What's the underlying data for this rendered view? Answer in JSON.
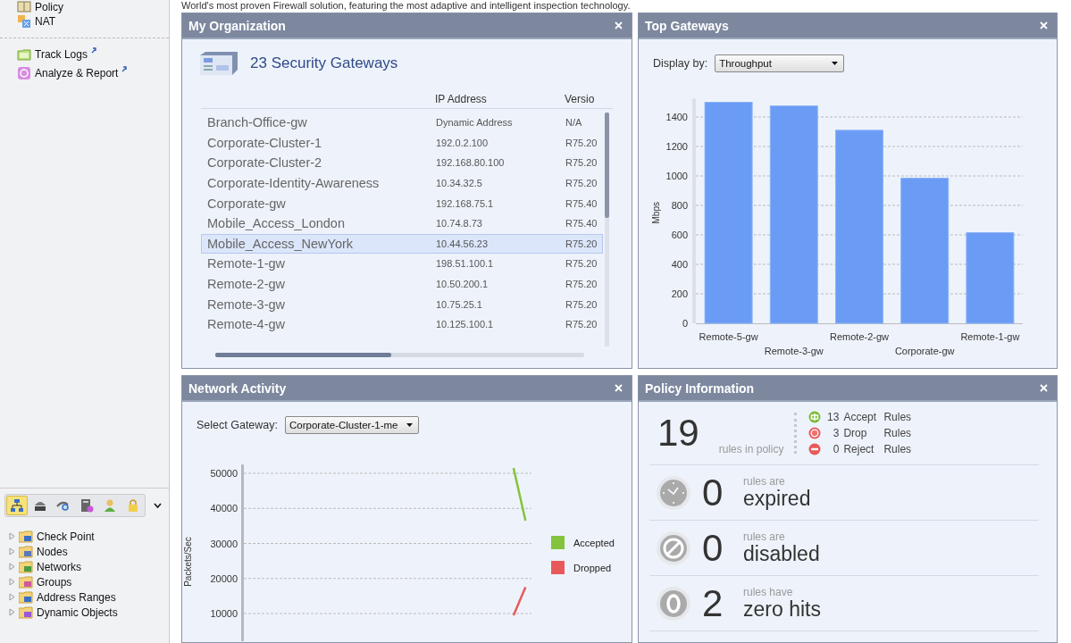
{
  "banner": {
    "text": "World's most proven Firewall solution, featuring the most adaptive and intelligent inspection technology."
  },
  "sidebar": {
    "top_items": [
      {
        "label": "Policy"
      },
      {
        "label": "NAT"
      }
    ],
    "links": [
      {
        "label": "Track Logs"
      },
      {
        "label": "Analyze & Report"
      }
    ],
    "toolbar": [
      {
        "selected": true
      },
      {
        "selected": false
      },
      {
        "selected": false
      },
      {
        "selected": false
      },
      {
        "selected": false
      },
      {
        "selected": false
      }
    ],
    "tree": [
      {
        "label": "Check Point",
        "expanded": false
      },
      {
        "label": "Nodes",
        "expanded": false
      },
      {
        "label": "Networks",
        "expanded": false
      },
      {
        "label": "Groups",
        "expanded": false
      },
      {
        "label": "Address Ranges",
        "expanded": false
      },
      {
        "label": "Dynamic Objects",
        "expanded": false
      }
    ]
  },
  "my_organization": {
    "title": "My Organization",
    "heading": "23 Security Gateways",
    "columns": [
      "IP Address",
      "Versio"
    ],
    "rows": [
      {
        "name": "Branch-Office-gw",
        "ip_address": "Dynamic Address",
        "column_3": "N/A",
        "selected": false
      },
      {
        "name": "Corporate-Cluster-1",
        "ip_address": "192.0.2.100",
        "column_3": "R75.20",
        "selected": false
      },
      {
        "name": "Corporate-Cluster-2",
        "ip_address": "192.168.80.100",
        "column_3": "R75.20",
        "selected": false
      },
      {
        "name": "Corporate-Identity-Awareness",
        "ip_address": "10.34.32.5",
        "column_3": "R75.20",
        "selected": false
      },
      {
        "name": "Corporate-gw",
        "ip_address": "192.168.75.1",
        "column_3": "R75.40",
        "selected": false
      },
      {
        "name": "Mobile_Access_London",
        "ip_address": "10.74.8.73",
        "column_3": "R75.40",
        "selected": false
      },
      {
        "name": "Mobile_Access_NewYork",
        "ip_address": "10.44.56.23",
        "column_3": "R75.20",
        "selected": true
      },
      {
        "name": "Remote-1-gw",
        "ip_address": "198.51.100.1",
        "column_3": "R75.20",
        "selected": false
      },
      {
        "name": "Remote-2-gw",
        "ip_address": "10.50.200.1",
        "column_3": "R75.20",
        "selected": false
      },
      {
        "name": "Remote-3-gw",
        "ip_address": "10.75.25.1",
        "column_3": "R75.20",
        "selected": false
      },
      {
        "name": "Remote-4-gw",
        "ip_address": "10.125.100.1",
        "column_3": "R75.20",
        "selected": false
      }
    ]
  },
  "top_gateways": {
    "title": "Top Gateways",
    "display_label": "Display by:",
    "display_value": "Throughput",
    "chart_data": {
      "type": "bar",
      "ylabel": "Mbps",
      "categories": [
        "Remote-5-gw",
        "Remote-3-gw",
        "Remote-2-gw",
        "Corporate-gw",
        "Remote-1-gw"
      ],
      "values": [
        1500,
        1475,
        1310,
        985,
        615
      ],
      "ylim": [
        0,
        1500
      ],
      "yticks": [
        0,
        200,
        400,
        600,
        800,
        1000,
        1200,
        1400
      ],
      "grid": true
    }
  },
  "network_activity": {
    "title": "Network Activity",
    "select_label": "Select Gateway:",
    "select_value": "Corporate-Cluster-1-me",
    "chart_data": {
      "type": "line",
      "ylabel": "Packets/Sec",
      "categories": [
        null,
        null,
        null,
        null,
        null,
        null,
        null,
        null,
        null,
        null,
        null,
        null,
        null,
        null,
        null,
        null,
        null,
        null,
        null,
        null,
        null,
        null,
        null,
        null
      ],
      "ylim": [
        2100,
        52500
      ],
      "yticks": [
        10000,
        20000,
        30000,
        40000,
        50000
      ],
      "grid": true,
      "legend": "right",
      "series": [
        {
          "name": "Accepted",
          "color": "#84c43c",
          "values": [
            null,
            null,
            null,
            null,
            null,
            null,
            null,
            null,
            null,
            null,
            null,
            null,
            null,
            null,
            null,
            null,
            null,
            null,
            null,
            null,
            null,
            null,
            51500,
            36500
          ]
        },
        {
          "name": "Dropped",
          "color": "#e85a5a",
          "values": [
            null,
            null,
            null,
            null,
            null,
            null,
            null,
            null,
            null,
            null,
            null,
            null,
            null,
            null,
            null,
            null,
            null,
            null,
            null,
            null,
            null,
            null,
            9500,
            17500
          ]
        }
      ]
    }
  },
  "policy_information": {
    "title": "Policy Information",
    "total": "19",
    "total_label": "rules in policy",
    "breakdown": [
      {
        "kind": "accept",
        "count": "13",
        "action": "Accept",
        "unit": "Rules"
      },
      {
        "kind": "drop",
        "count": "3",
        "action": "Drop",
        "unit": "Rules"
      },
      {
        "kind": "reject",
        "count": "0",
        "action": "Reject",
        "unit": "Rules"
      }
    ],
    "stats": [
      {
        "kind": "expired",
        "value": "0",
        "caption": "rules are",
        "label": "expired"
      },
      {
        "kind": "disabled",
        "value": "0",
        "caption": "rules are",
        "label": "disabled"
      },
      {
        "kind": "zero_hits",
        "value": "2",
        "caption": "rules have",
        "label": "zero hits"
      }
    ]
  }
}
